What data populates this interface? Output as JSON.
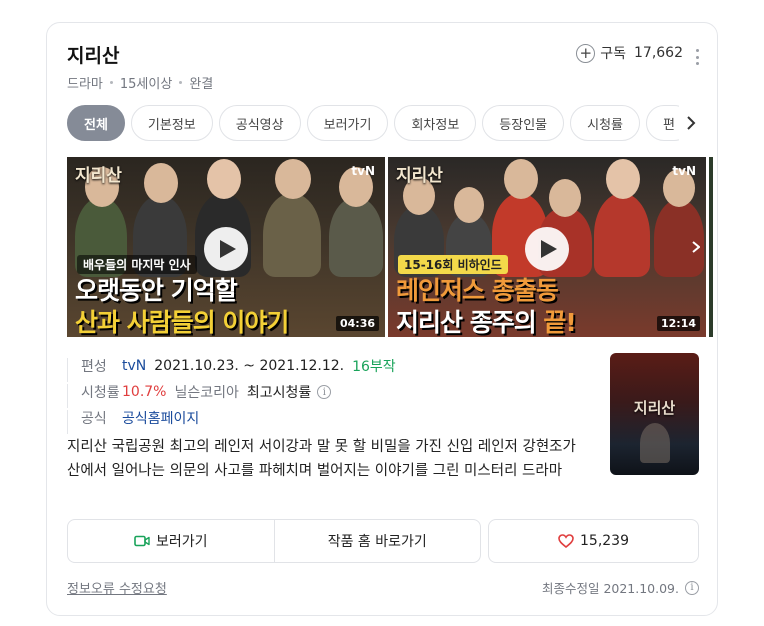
{
  "header": {
    "title": "지리산",
    "meta": [
      "드라마",
      "15세이상",
      "완결"
    ],
    "subscribe_label": "구독",
    "subscribe_count": "17,662"
  },
  "tabs": [
    "전체",
    "기본정보",
    "공식영상",
    "보러가기",
    "회차정보",
    "등장인물",
    "시청률",
    "편"
  ],
  "videos": [
    {
      "logo": "지리산",
      "channel": "tvN",
      "caption_top": "배우들의 마지막 인사",
      "caption_line1": "오랫동안 기억할",
      "caption_line2": "산과 사람들의 이야기",
      "duration": "04:36"
    },
    {
      "logo": "지리산",
      "channel": "tvN",
      "caption_top": "15-16회 비하인드",
      "caption_line1": "레인저스 총출동",
      "caption_line2_main": "지리산 종주의 ",
      "caption_line2_accent": "끝!",
      "duration": "12:14"
    }
  ],
  "info": {
    "broadcast_label": "편성",
    "broadcast_channel": "tvN",
    "broadcast_period": "2021.10.23. ~ 2021.12.12.",
    "broadcast_episodes": "16부작",
    "ratings_label": "시청률",
    "ratings_value": "10.7%",
    "ratings_source": "닐슨코리아",
    "ratings_note": "최고시청률",
    "official_label": "공식",
    "official_link": "공식홈페이지"
  },
  "description": "지리산 국립공원 최고의 레인저 서이강과 말 못 할 비밀을 가진 신입 레인저 강현조가 산에서 일어나는 의문의 사고를 파헤치며 벌어지는 이야기를 그린 미스터리 드라마",
  "poster": {
    "title": "지리산"
  },
  "actions": {
    "watch_label": "보러가기",
    "home_label": "작품 홈 바로가기",
    "like_count": "15,239"
  },
  "footer": {
    "report_label": "정보오류 수정요청",
    "updated_label": "최종수정일 2021.10.09."
  },
  "colors": {
    "active_tab": "#858b97",
    "link": "#1a4b9c",
    "green": "#19a35a",
    "red": "#e03e3e",
    "heart": "#e03e3e",
    "video_icon": "#19a35a"
  }
}
